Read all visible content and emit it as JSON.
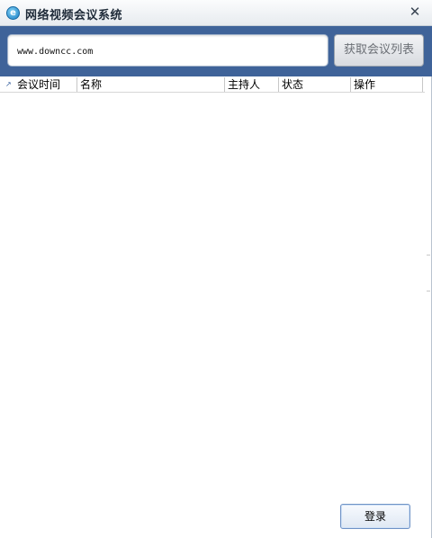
{
  "window": {
    "title": "网络视频会议系统",
    "app_icon_glyph": "e",
    "close_glyph": "✕"
  },
  "toolbar": {
    "url_value": "www.downcc.com",
    "fetch_label": "获取会议列表"
  },
  "table": {
    "sort_glyph": "↗",
    "columns": [
      {
        "label": "会议时间"
      },
      {
        "label": "名称"
      },
      {
        "label": "主持人"
      },
      {
        "label": "状态"
      },
      {
        "label": "操作"
      }
    ],
    "rows": []
  },
  "footer": {
    "login_label": "登录"
  },
  "colors": {
    "toolbar_bg": "#3f6399",
    "accent": "#1a7fc4"
  }
}
